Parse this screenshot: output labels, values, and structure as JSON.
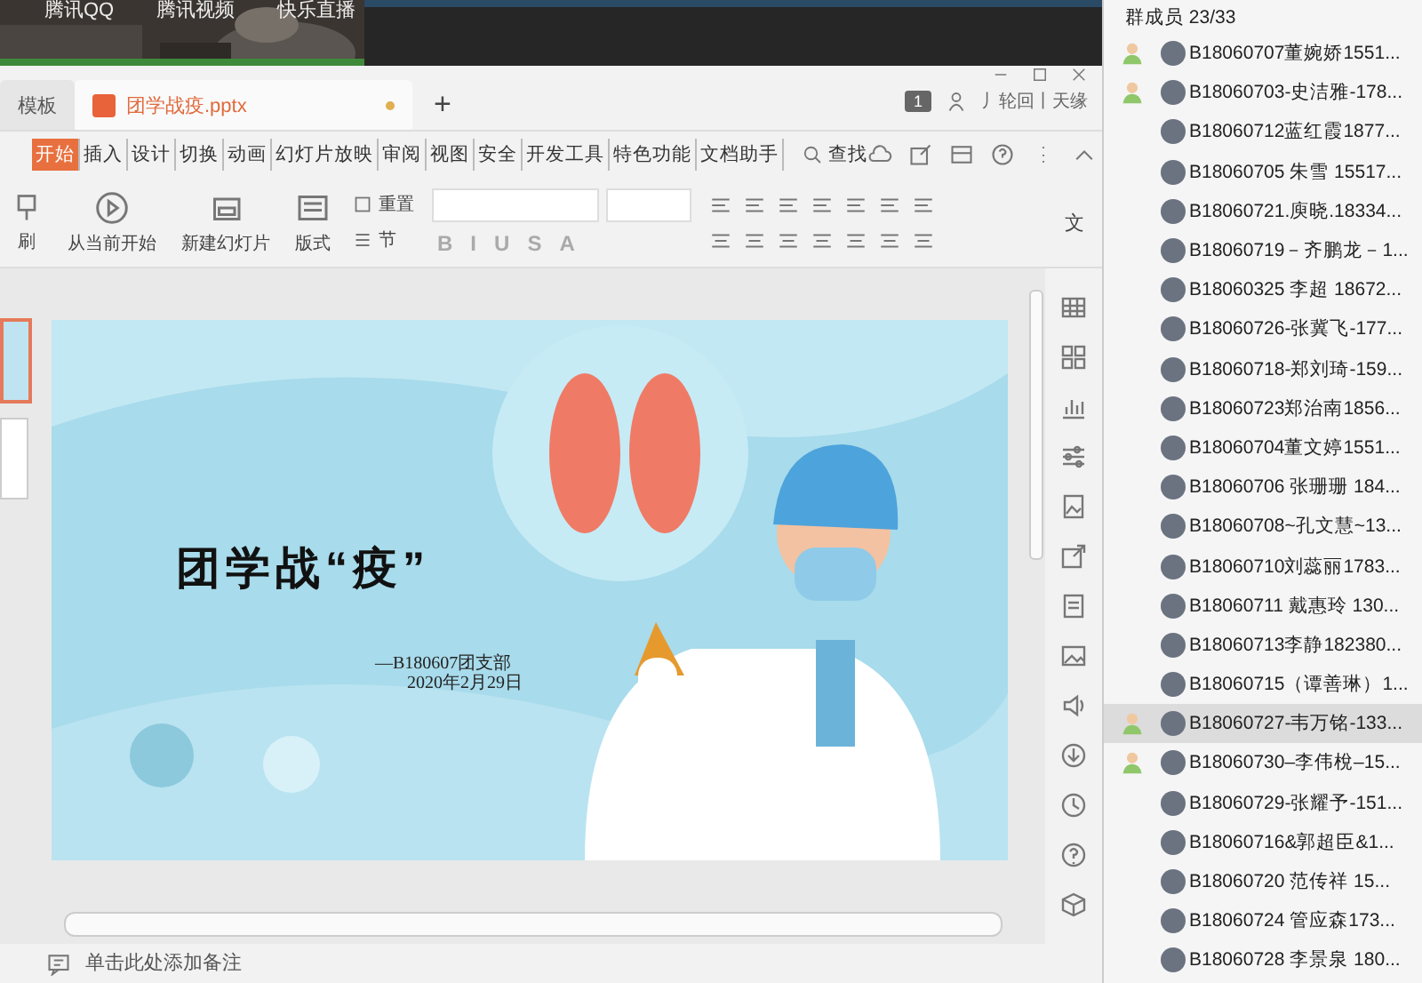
{
  "desktop": {
    "shortcuts": [
      "腾讯QQ",
      "腾讯视频",
      "快乐直播"
    ]
  },
  "window": {
    "tabs": [
      {
        "label": "模板",
        "selected": false
      },
      {
        "label": "团学战疫.pptx",
        "selected": true
      }
    ],
    "new_tab": "+",
    "badge": "1",
    "user": "丿轮回丨天缘",
    "menu": [
      {
        "label": "开始",
        "selected": true
      },
      {
        "label": "插入",
        "selected": false
      },
      {
        "label": "设计",
        "selected": false
      },
      {
        "label": "切换",
        "selected": false
      },
      {
        "label": "动画",
        "selected": false
      },
      {
        "label": "幻灯片放映",
        "selected": false
      },
      {
        "label": "审阅",
        "selected": false
      },
      {
        "label": "视图",
        "selected": false
      },
      {
        "label": "安全",
        "selected": false
      },
      {
        "label": "开发工具",
        "selected": false
      },
      {
        "label": "特色功能",
        "selected": false
      },
      {
        "label": "文档助手",
        "selected": false
      }
    ],
    "search": "查找",
    "toolbar": {
      "cut_label": "刷",
      "play_from_current": "从当前开始",
      "new_slide": "新建幻灯片",
      "layout": "版式",
      "reset": "重置",
      "section": "节",
      "format_buttons": [
        "B",
        "I",
        "U",
        "S",
        "A"
      ],
      "text_tool": "文"
    },
    "thumbnails": [
      {
        "selected": true
      },
      {
        "selected": false
      }
    ],
    "slide": {
      "title": "团学战“疫”",
      "subtitle": "—B180607团支部",
      "date": "2020年2月29日"
    },
    "notes": {
      "placeholder": "单击此处添加备注"
    }
  },
  "group": {
    "title": "群成员 23/33",
    "members": [
      {
        "text": "B18060707董婉娇1551...",
        "admin": true,
        "selected": false
      },
      {
        "text": "B18060703-史洁雅-178...",
        "admin": true,
        "selected": false
      },
      {
        "text": "B18060712蓝红霞1877...",
        "admin": false,
        "selected": false
      },
      {
        "text": "B18060705 朱雪 15517...",
        "admin": false,
        "selected": false
      },
      {
        "text": "B18060721.庾晓.18334...",
        "admin": false,
        "selected": false
      },
      {
        "text": "B18060719－齐鹏龙－1...",
        "admin": false,
        "selected": false
      },
      {
        "text": "B18060325 李超 18672...",
        "admin": false,
        "selected": false
      },
      {
        "text": "B18060726-张冀飞-177...",
        "admin": false,
        "selected": false
      },
      {
        "text": "B18060718-郑刘琦-159...",
        "admin": false,
        "selected": false
      },
      {
        "text": "B18060723郑治南1856...",
        "admin": false,
        "selected": false
      },
      {
        "text": "B18060704董文婷1551...",
        "admin": false,
        "selected": false
      },
      {
        "text": "B18060706 张珊珊 184...",
        "admin": false,
        "selected": false
      },
      {
        "text": "B18060708~孔文慧~13...",
        "admin": false,
        "selected": false
      },
      {
        "text": "B18060710刘蕊丽1783...",
        "admin": false,
        "selected": false
      },
      {
        "text": "B18060711 戴惠玲 130...",
        "admin": false,
        "selected": false
      },
      {
        "text": "B18060713李静182380...",
        "admin": false,
        "selected": false
      },
      {
        "text": "B18060715（谭善琳）1...",
        "admin": false,
        "selected": false
      },
      {
        "text": "B18060727-韦万铭-133...",
        "admin": true,
        "selected": true
      },
      {
        "text": "B18060730–李伟梲–15...",
        "admin": true,
        "selected": false
      },
      {
        "text": "B18060729-张耀予-151...",
        "admin": false,
        "selected": false
      },
      {
        "text": "B18060716&郭超臣&1...",
        "admin": false,
        "selected": false
      },
      {
        "text": "B18060720 范传祥 15...",
        "admin": false,
        "selected": false
      },
      {
        "text": "B18060724 管应森173...",
        "admin": false,
        "selected": false
      },
      {
        "text": "B18060728 李景泉 180...",
        "admin": false,
        "selected": false
      }
    ]
  }
}
